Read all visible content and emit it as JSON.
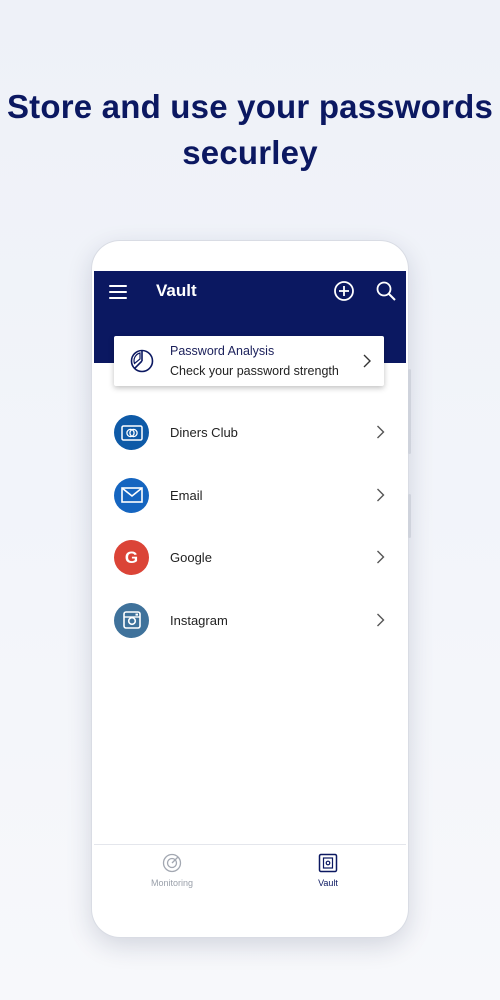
{
  "headline": {
    "line1": "Store and use your passwords",
    "line2": "securley"
  },
  "appbar": {
    "title": "Vault"
  },
  "analysis": {
    "title": "Password Analysis",
    "subtitle": "Check your password strength"
  },
  "items": [
    {
      "label": "Diners Club",
      "icon": "card-icon",
      "color": "#0e5aa7"
    },
    {
      "label": "Email",
      "icon": "envelope-icon",
      "color": "#1565c0"
    },
    {
      "label": "Google",
      "icon": "google-g-icon",
      "color": "#db4437",
      "glyph": "G"
    },
    {
      "label": "Instagram",
      "icon": "instagram-icon",
      "color": "#3f729b"
    }
  ],
  "bottom_nav": {
    "monitoring": "Monitoring",
    "vault": "Vault",
    "active": "Vault"
  },
  "colors": {
    "brand": "#0b1861",
    "background": "#eef1f8"
  }
}
